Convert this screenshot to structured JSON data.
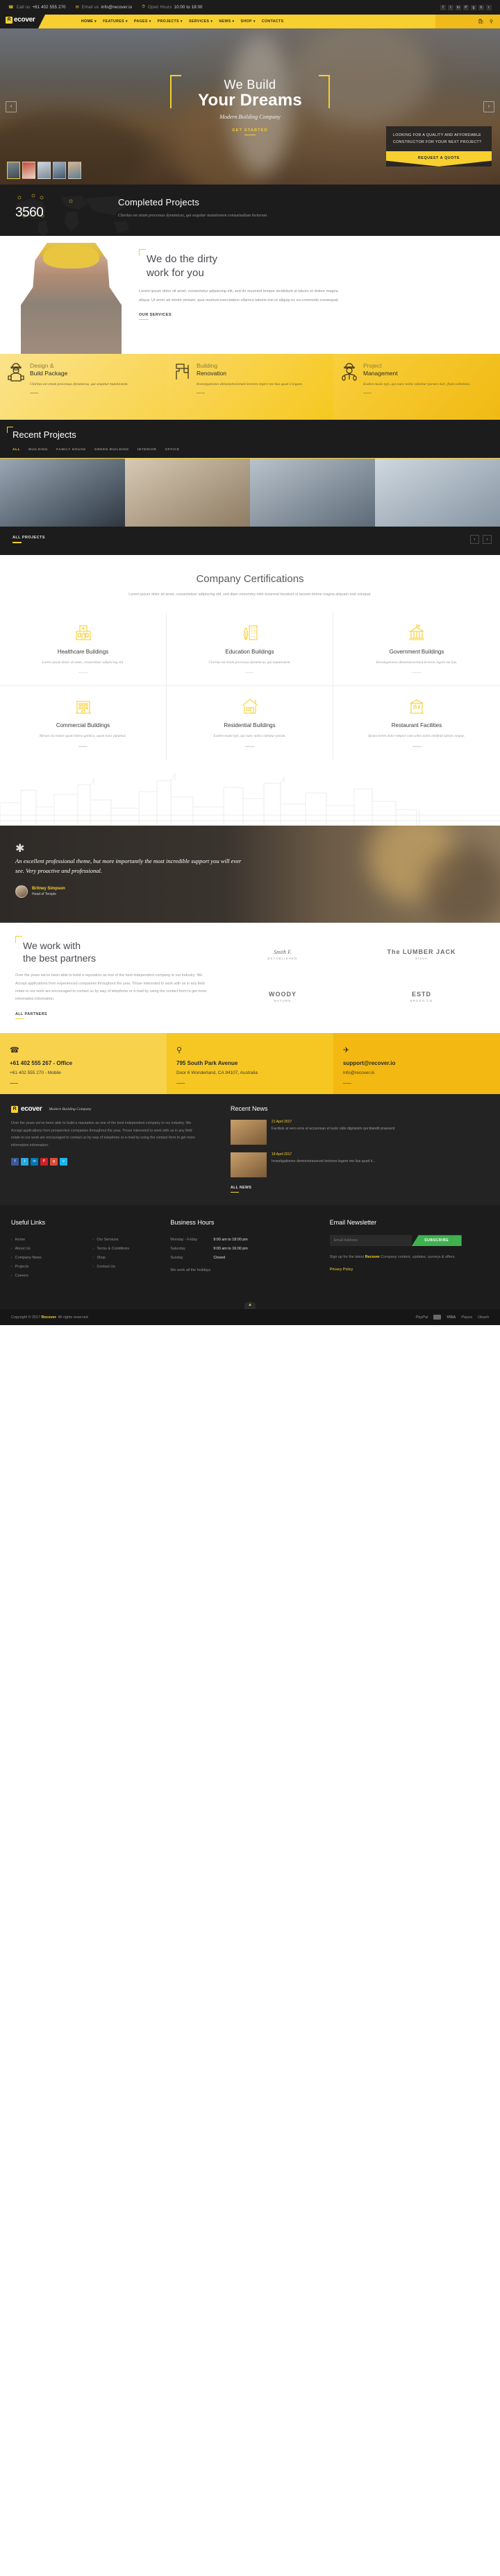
{
  "topbar": {
    "phone_label": "Call us",
    "phone": "+61 402 555 270",
    "email_label": "Email us",
    "email": "info@recover.io",
    "hours_label": "Open Hours",
    "hours": "10:00 to 18:00",
    "social": [
      "facebook-icon",
      "twitter-icon",
      "linkedin-icon",
      "pinterest-icon",
      "google-plus-icon",
      "behance-icon",
      "rss-icon"
    ],
    "social_glyphs": [
      "f",
      "t",
      "in",
      "P",
      "g",
      "b",
      "r"
    ]
  },
  "nav": {
    "logo_mark": "R",
    "logo_name": "ecover",
    "items": [
      {
        "label": "HOME",
        "active": true,
        "caret": true
      },
      {
        "label": "FEATURES",
        "active": false,
        "caret": true
      },
      {
        "label": "PAGES",
        "active": false,
        "caret": true
      },
      {
        "label": "PROJECTS",
        "active": false,
        "caret": true
      },
      {
        "label": "SERVICES",
        "active": false,
        "caret": true
      },
      {
        "label": "NEWS",
        "active": false,
        "caret": true
      },
      {
        "label": "SHOP",
        "active": false,
        "caret": true
      },
      {
        "label": "CONTACTS",
        "active": false,
        "caret": false
      }
    ],
    "cart_icon": "shopping-bag-icon",
    "search_icon": "search-icon"
  },
  "hero": {
    "line1": "We Build",
    "line2": "Your Dreams",
    "subtitle": "Modern Building Company",
    "cta": "GET STARTED",
    "prev_icon": "chevron-left-icon",
    "next_icon": "chevron-right-icon",
    "thumb_count": 5,
    "quote_text": "LOOKING FOR A QUALITY AND AFFORDABLE CONSTRUCTOR FOR YOUR NEXT PROJECT?",
    "quote_button": "REQUEST A QUOTE"
  },
  "counter": {
    "number": "3560",
    "title": "Completed Projects",
    "text": "Claritas est etiam processus dynamicus, qui sequitur mutationem consuetudium lectorum."
  },
  "dirty": {
    "heading_line1": "We do the dirty",
    "heading_line2": "work for you",
    "paragraph": "Lorem ipsum dolor sit amet, consectetur adipiscing elit, sed do eiusmod tempor incididunt ut labore et dolore magna aliqua. Ut enim ad minim veniam, quis nostrud exercitation ullamco laboris nisi ut aliquip ex ea commodo consequat.",
    "button": "OUR SERVICES"
  },
  "services": [
    {
      "icon": "worker-icon",
      "title_light": "Design &",
      "title_bold": "Build Package",
      "text": "Claritas est etiam processus dynamicus, qui sequitur mutationem."
    },
    {
      "icon": "paint-roller-icon",
      "title_light": "Building",
      "title_bold": "Renovation",
      "text": "Investigationes demonstraverunt lectores legere me lius quod ii legunt."
    },
    {
      "icon": "manager-icon",
      "title_light": "Project",
      "title_bold": "Management",
      "text": "Eodem modo typi, qui nunc nobis videntur parum clari, fiant sollemnes."
    }
  ],
  "projects": {
    "heading": "Recent Projects",
    "filters": [
      {
        "label": "ALL",
        "active": true
      },
      {
        "label": "BUILDING",
        "active": false
      },
      {
        "label": "FAMILY HOUSE",
        "active": false
      },
      {
        "label": "GREEN BUILDING",
        "active": false
      },
      {
        "label": "INTERIOR",
        "active": false
      },
      {
        "label": "OFFICE",
        "active": false
      }
    ],
    "all_button": "ALL PROJECTS",
    "prev_icon": "chevron-left-icon",
    "next_icon": "chevron-right-icon"
  },
  "certifications": {
    "heading": "Company Certifications",
    "subtext": "Lorem ipsum dolor sit amet, consectetuer adipiscing elit, sed diam nonummy nibh euismod tincidunt ut laoreet dolore magna aliquam erat volutpat.",
    "items": [
      {
        "icon": "hospital-icon",
        "title": "Healthcare Buildings",
        "desc": "Lorem ipsum dolor sit amet, consectetuer adipiscing elit."
      },
      {
        "icon": "school-icon",
        "title": "Education Buildings",
        "desc": "Claritas est etiam processus dynamicus, qui mutationem."
      },
      {
        "icon": "capitol-icon",
        "title": "Government Buildings",
        "desc": "Investigationes demonstraverunt lectores legere me lius."
      },
      {
        "icon": "office-icon",
        "title": "Commercial Buildings",
        "desc": "Mirum est notare quam littera gothica, quam nunc putamus."
      },
      {
        "icon": "house-icon",
        "title": "Residential Buildings",
        "desc": "Eodem modo typi, qui nunc nobis videntur parum."
      },
      {
        "icon": "restaurant-icon",
        "title": "Restaurant Facilities",
        "desc": "Ipsum lorem dolor tempor cum urbes nobis eleifend option congue."
      }
    ]
  },
  "testimonial": {
    "quote": "An excellent professional theme, but more importantly the most incredible support you will ever see. Very proactive and professional.",
    "author": "Britney Simpson",
    "role": "Head of Temple"
  },
  "partners": {
    "heading_line1": "We work with",
    "heading_line2": "the best partners",
    "paragraph": "Over the years we've been able to build a reputation as one of the best independent company in our industry. We Accept applications from experienced companies throughout the year. Those interested to work with us in any field relate to our work are encouraged to contact us by way of telephone or e-mail by using the contact form to get more information information.",
    "button": "ALL PARTNERS",
    "logos": [
      {
        "name": "Smith F.",
        "sub": "ESTABLISHED"
      },
      {
        "name": "The LUMBER JACK",
        "sub": "SILVA"
      },
      {
        "name": "WOODY",
        "sub": "NATURE"
      },
      {
        "name": "ESTD",
        "sub": "BRUSH CO"
      }
    ]
  },
  "contact_strip": [
    {
      "icon": "phone-icon",
      "title": "+61 402 555 267 - Office",
      "sub": "+61 402 555 270 - Mobile"
    },
    {
      "icon": "map-pin-icon",
      "title": "795 South Park Avenue",
      "sub": "Door 6 Wonderland, CA 94107, Australia"
    },
    {
      "icon": "paper-plane-icon",
      "title": "support@recover.io",
      "sub": "info@recover.io"
    }
  ],
  "footer_top": {
    "logo_mark": "R",
    "logo_name": "ecover",
    "tagline": "Modern Building Company",
    "about": "Over the years we've been able to build a reputation as one of the best independent company in our industry. We Accept applications from prospective companies throughout the year. Those interested to work with us in any field relate to our work are encouraged to contact us by way of telephone or e-mail by using the contact form to get more information information.",
    "social": [
      "facebook-icon",
      "twitter-icon",
      "linkedin-icon",
      "pinterest-icon",
      "google-plus-icon",
      "vimeo-icon"
    ],
    "social_glyphs": [
      "f",
      "t",
      "in",
      "P",
      "g",
      "v"
    ],
    "news_heading": "Recent News",
    "news": [
      {
        "date": "21 April 2017",
        "title": "Facilisis at vero eros et accumsan et iusto odio dignissim qui blandit praesent"
      },
      {
        "date": "18 April 2017",
        "title": "Investigationes demonstraverunt lectores legere me lius quod ii..."
      }
    ],
    "all_news": "ALL NEWS"
  },
  "footer": {
    "links_heading": "Useful Links",
    "links_col1": [
      "Home",
      "About Us",
      "Company News",
      "Projects",
      "Careers"
    ],
    "links_col2": [
      "Our Services",
      "Terms & Conditions",
      "Shop",
      "Contact Us"
    ],
    "hours_heading": "Business Hours",
    "hours": [
      {
        "day": "Monday - Friday",
        "value": "9:00 am to 18:00 pm"
      },
      {
        "day": "Saturday",
        "value": "9:00 am to 16:00 pm"
      },
      {
        "day": "Sunday",
        "value": "Closed"
      }
    ],
    "hours_note": "We work all the holidays",
    "newsletter_heading": "Email Newsletter",
    "newsletter_placeholder": "Email Address",
    "newsletter_button": "SUBSCRIBE",
    "newsletter_text_a": "Sign up for the latest ",
    "newsletter_brand": "Recover",
    "newsletter_text_b": " Company content, updates, surveys & offers.",
    "privacy": "Privacy Policy"
  },
  "bottom": {
    "to_top_icon": "chevron-up-icon",
    "copyright_a": "Copyright © 2017 ",
    "copyright_brand": "Recover",
    "copyright_b": ". All rights reserved",
    "payments": [
      "PayPal",
      "Mastercard",
      "VISA",
      "Payza",
      "Okash"
    ]
  },
  "colors": {
    "accent": "#f7cf2e",
    "dark": "#1c1c1c",
    "green": "#3fb14f"
  }
}
